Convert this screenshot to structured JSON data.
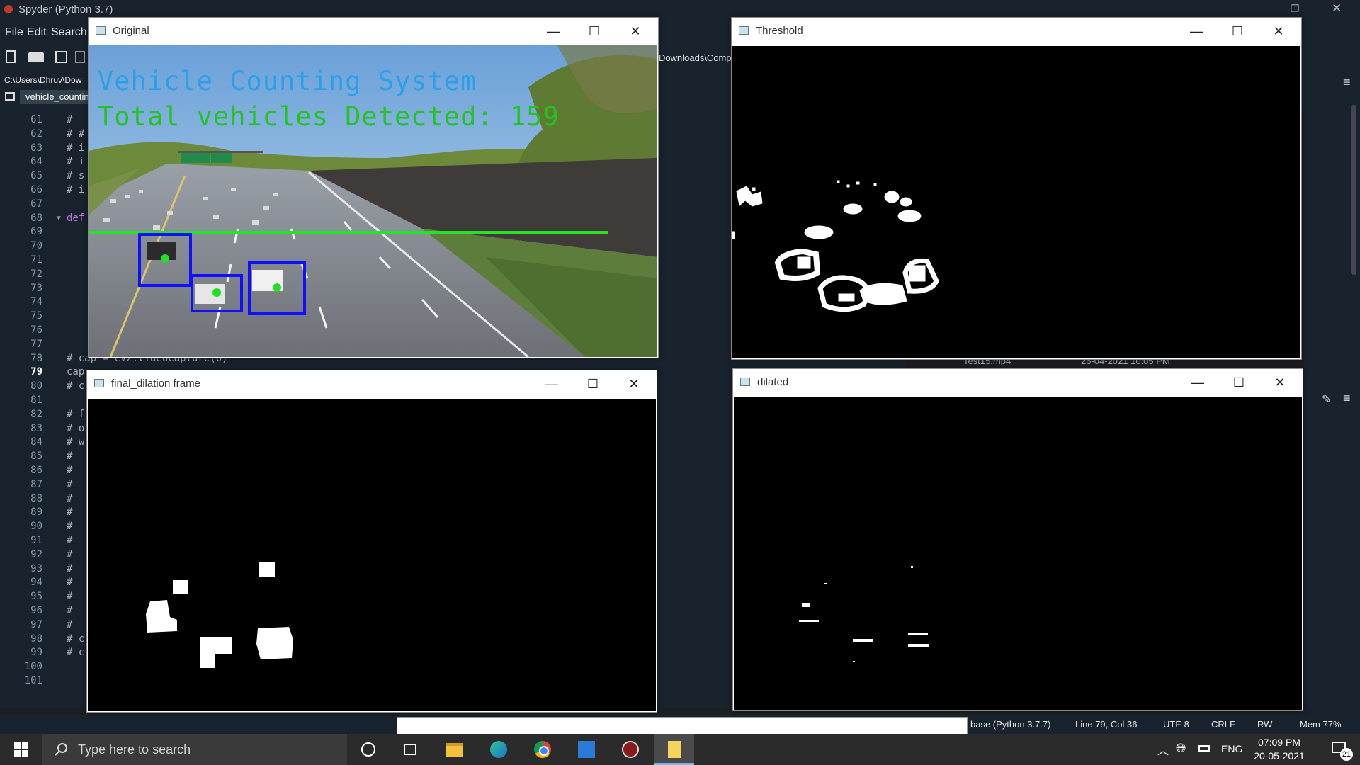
{
  "spyder": {
    "title": "Spyder (Python 3.7)",
    "menu": [
      "File",
      "Edit",
      "Search"
    ],
    "path": "C:\\Users\\Dhruv\\Dow",
    "path_right": "Downloads\\Comp",
    "tab": "vehicle_countin",
    "lines": [
      {
        "n": "61",
        "code": "#"
      },
      {
        "n": "62",
        "code": "# #"
      },
      {
        "n": "63",
        "code": "# i"
      },
      {
        "n": "64",
        "code": "# i"
      },
      {
        "n": "65",
        "code": "# s"
      },
      {
        "n": "66",
        "code": "# i"
      },
      {
        "n": "67",
        "code": ""
      },
      {
        "n": "68",
        "code": "def"
      },
      {
        "n": "69",
        "code": ""
      },
      {
        "n": "70",
        "code": ""
      },
      {
        "n": "71",
        "code": ""
      },
      {
        "n": "72",
        "code": ""
      },
      {
        "n": "73",
        "code": ""
      },
      {
        "n": "74",
        "code": ""
      },
      {
        "n": "75",
        "code": ""
      },
      {
        "n": "76",
        "code": ""
      },
      {
        "n": "77",
        "code": ""
      },
      {
        "n": "78",
        "code": "# cap = cv2.VideoCapture(0)"
      },
      {
        "n": "79",
        "code": "cap"
      },
      {
        "n": "80",
        "code": "# c"
      },
      {
        "n": "81",
        "code": ""
      },
      {
        "n": "82",
        "code": "# f"
      },
      {
        "n": "83",
        "code": "# o"
      },
      {
        "n": "84",
        "code": "# w"
      },
      {
        "n": "85",
        "code": "#"
      },
      {
        "n": "86",
        "code": "#"
      },
      {
        "n": "87",
        "code": "#"
      },
      {
        "n": "88",
        "code": "#"
      },
      {
        "n": "89",
        "code": "#"
      },
      {
        "n": "90",
        "code": "#"
      },
      {
        "n": "91",
        "code": "#"
      },
      {
        "n": "92",
        "code": "#"
      },
      {
        "n": "93",
        "code": "#"
      },
      {
        "n": "94",
        "code": "#"
      },
      {
        "n": "95",
        "code": "#"
      },
      {
        "n": "96",
        "code": "#"
      },
      {
        "n": "97",
        "code": "#"
      },
      {
        "n": "98",
        "code": "# c"
      },
      {
        "n": "99",
        "code": "# c"
      },
      {
        "n": "100",
        "code": ""
      },
      {
        "n": "101",
        "code": ""
      }
    ],
    "file_row_name": "Test15.mp4",
    "file_row_date": "26-04-2021 10:05 PM",
    "status": {
      "env": "base (Python 3.7.7)",
      "pos": "Line 79, Col 36",
      "enc": "UTF-8",
      "eol": "CRLF",
      "rw": "RW",
      "mem": "Mem 77%"
    }
  },
  "windows": {
    "original": {
      "title": "Original",
      "overlay_line1": "Vehicle Counting System",
      "overlay_line2": "Total vehicles Detected: 159"
    },
    "threshold": {
      "title": "Threshold"
    },
    "final_dilation": {
      "title": "final_dilation frame"
    },
    "dilated": {
      "title": "dilated"
    },
    "controls": {
      "minimize": "—",
      "maximize": "☐",
      "close": "✕"
    }
  },
  "taskbar": {
    "search_placeholder": "Type here to search",
    "lang": "ENG",
    "time": "07:09 PM",
    "date": "20-05-2021",
    "notifications": "21"
  },
  "colors": {
    "overlay_title": "#2aa0e8",
    "overlay_count": "#21c421",
    "box": "#1010ff",
    "count_line": "#27e327"
  }
}
